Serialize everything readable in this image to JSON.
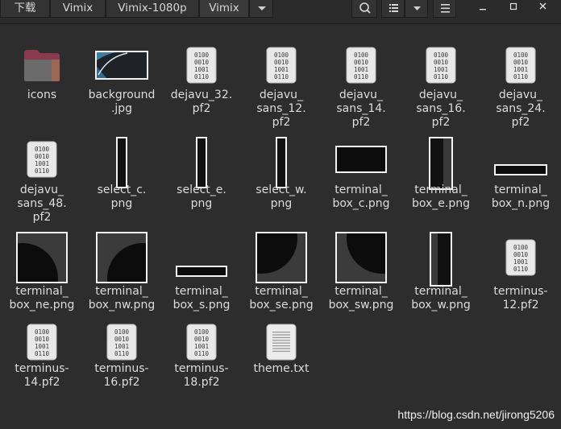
{
  "header": {
    "breadcrumbs": [
      "下载",
      "Vimix",
      "Vimix-1080p",
      "Vimix"
    ],
    "icons": [
      "search-icon",
      "list-view-icon",
      "chevron-down-icon",
      "hamburger-menu-icon",
      "minimize-icon",
      "maximize-icon",
      "close-icon"
    ]
  },
  "files": [
    {
      "name": "icons",
      "type": "folder"
    },
    {
      "name": "background\n.jpg",
      "type": "image-background"
    },
    {
      "name": "dejavu_32.\npf2",
      "type": "binary"
    },
    {
      "name": "dejavu_\nsans_12.\npf2",
      "type": "binary"
    },
    {
      "name": "dejavu_\nsans_14.\npf2",
      "type": "binary"
    },
    {
      "name": "dejavu_\nsans_16.\npf2",
      "type": "binary"
    },
    {
      "name": "dejavu_\nsans_24.\npf2",
      "type": "binary"
    },
    {
      "name": "dejavu_\nsans_48.\npf2",
      "type": "binary"
    },
    {
      "name": "select_c.\npng",
      "type": "image-vbar"
    },
    {
      "name": "select_e.\npng",
      "type": "image-vbar"
    },
    {
      "name": "select_w.\npng",
      "type": "image-vbar"
    },
    {
      "name": "terminal_\nbox_c.png",
      "type": "image-box-c"
    },
    {
      "name": "terminal_\nbox_e.png",
      "type": "image-box-e"
    },
    {
      "name": "terminal_\nbox_n.png",
      "type": "image-box-n"
    },
    {
      "name": "terminal_\nbox_ne.png",
      "type": "image-corner-ne"
    },
    {
      "name": "terminal_\nbox_nw.png",
      "type": "image-corner-nw"
    },
    {
      "name": "terminal_\nbox_s.png",
      "type": "image-box-s"
    },
    {
      "name": "terminal_\nbox_se.png",
      "type": "image-corner-se"
    },
    {
      "name": "terminal_\nbox_sw.png",
      "type": "image-corner-sw"
    },
    {
      "name": "terminal_\nbox_w.png",
      "type": "image-box-w"
    },
    {
      "name": "terminus-\n12.pf2",
      "type": "binary"
    },
    {
      "name": "terminus-\n14.pf2",
      "type": "binary"
    },
    {
      "name": "terminus-\n16.pf2",
      "type": "binary"
    },
    {
      "name": "terminus-\n18.pf2",
      "type": "binary"
    },
    {
      "name": "theme.txt",
      "type": "text"
    }
  ],
  "watermark": "https://blog.csdn.net/jirong5206"
}
